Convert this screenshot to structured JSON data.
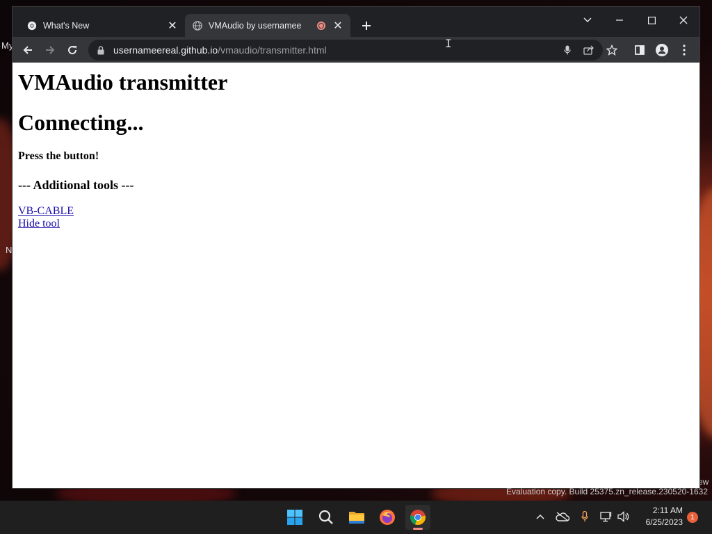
{
  "browser": {
    "tabs": [
      {
        "title": "What's New",
        "icon": "chrome-icon",
        "active": false
      },
      {
        "title": "VMAudio by usernamee",
        "icon": "globe-icon",
        "active": true,
        "recording": true
      }
    ],
    "address": {
      "host": "usernameereal.github.io",
      "path": "/vmaudio/transmitter.html"
    }
  },
  "page": {
    "heading": "VMAudio transmitter",
    "status": "Connecting...",
    "instruction": "Press the button!",
    "tools_heading": "--- Additional tools ---",
    "links": [
      "VB-CABLE",
      "Hide tool"
    ]
  },
  "desktop": {
    "fragments": [
      "My",
      "N",
      "ew"
    ],
    "watermark": "Evaluation copy. Build 25375.zn_release.230520-1632"
  },
  "taskbar": {
    "apps": [
      "start-icon",
      "search-icon",
      "file-explorer-icon",
      "firefox-icon",
      "chrome-icon"
    ],
    "time": "2:11 AM",
    "date": "6/25/2023",
    "notification_count": "1"
  }
}
